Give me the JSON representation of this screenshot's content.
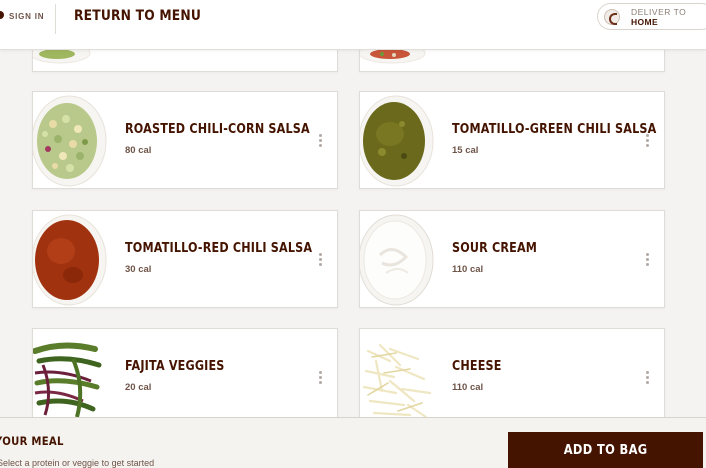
{
  "header": {
    "sign_in": "SIGN IN",
    "return_to_menu": "RETURN TO MENU",
    "deliver_to_label": "DELIVER TO",
    "deliver_to_value": "HOME"
  },
  "items": [
    {
      "name": "ROASTED CHILI-CORN SALSA",
      "cal": "80 cal",
      "icon": "corn-salsa-bowl"
    },
    {
      "name": "TOMATILLO-GREEN CHILI SALSA",
      "cal": "15 cal",
      "icon": "green-salsa-bowl"
    },
    {
      "name": "TOMATILLO-RED CHILI SALSA",
      "cal": "30 cal",
      "icon": "red-salsa-bowl"
    },
    {
      "name": "SOUR CREAM",
      "cal": "110 cal",
      "icon": "sour-cream-bowl"
    },
    {
      "name": "FAJITA VEGGIES",
      "cal": "20 cal",
      "icon": "fajita-veggies"
    },
    {
      "name": "CHEESE",
      "cal": "110 cal",
      "icon": "cheese"
    }
  ],
  "bottom_bar": {
    "title": "YOUR MEAL",
    "subtitle": "Select a protein or veggie to get started",
    "add_to_bag": "ADD TO BAG"
  },
  "colors": {
    "brand_dark": "#451400",
    "background": "#f4f3f1"
  }
}
